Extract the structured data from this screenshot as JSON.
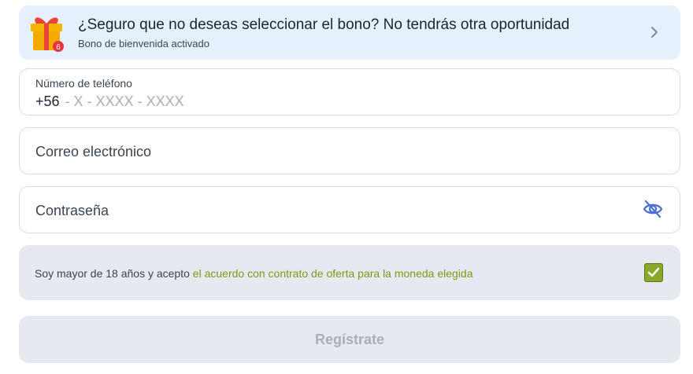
{
  "banner": {
    "title": "¿Seguro que no deseas seleccionar el bono? No tendrás otra oportunidad",
    "subtitle": "Bono de bienvenida activado",
    "badge_count": "6",
    "icon": "gift-icon"
  },
  "form": {
    "phone": {
      "label": "Número de teléfono",
      "country_code": "+56",
      "mask": "- X - XXXX - XXXX"
    },
    "email": {
      "placeholder": "Correo electrónico"
    },
    "password": {
      "placeholder": "Contraseña",
      "visibility_icon": "eye-off-icon"
    },
    "consent": {
      "text": "Soy mayor de 18 años y acepto",
      "link": "el acuerdo con contrato de oferta para la moneda elegida",
      "checked": true
    },
    "submit_label": "Regístrate"
  },
  "colors": {
    "banner_bg": "#e6f0fc",
    "accent_green": "#8aa82a",
    "link_green": "#7a9a1a",
    "icon_blue": "#4b6fd1",
    "disabled_text": "#a7afbd",
    "badge_red": "#e5333f"
  }
}
